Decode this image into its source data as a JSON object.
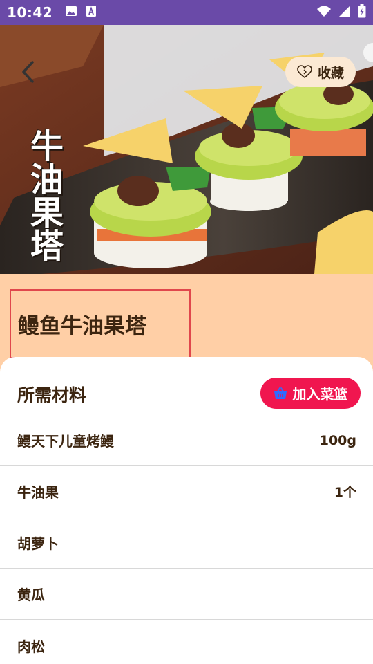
{
  "status_bar": {
    "time": "10:42",
    "icons": [
      "image-icon",
      "a-badge-icon",
      "wifi-icon",
      "signal-icon",
      "battery-icon"
    ]
  },
  "hero": {
    "calligraphy": "牛油果塔",
    "favorite_label": "收藏",
    "back_icon": "back-arrow-icon",
    "favorite_icon": "heart-icon"
  },
  "recipe": {
    "title": "鳗鱼牛油果塔"
  },
  "ingredients": {
    "section_title": "所需材料",
    "add_to_basket_label": "加入菜篮",
    "basket_icon": "basket-icon",
    "items": [
      {
        "name": "鳗天下儿童烤鳗",
        "amount": "100g"
      },
      {
        "name": "牛油果",
        "amount": "1个"
      },
      {
        "name": "胡萝卜",
        "amount": ""
      },
      {
        "name": "黄瓜",
        "amount": ""
      },
      {
        "name": "肉松",
        "amount": ""
      }
    ]
  },
  "colors": {
    "status_bar": "#6a4aa8",
    "page_background": "#ffcfa6",
    "title_highlight_border": "#e0474c",
    "basket_button": "#f0164f",
    "favorite_button": "#fbe9d4",
    "text_primary": "#3c2510"
  }
}
